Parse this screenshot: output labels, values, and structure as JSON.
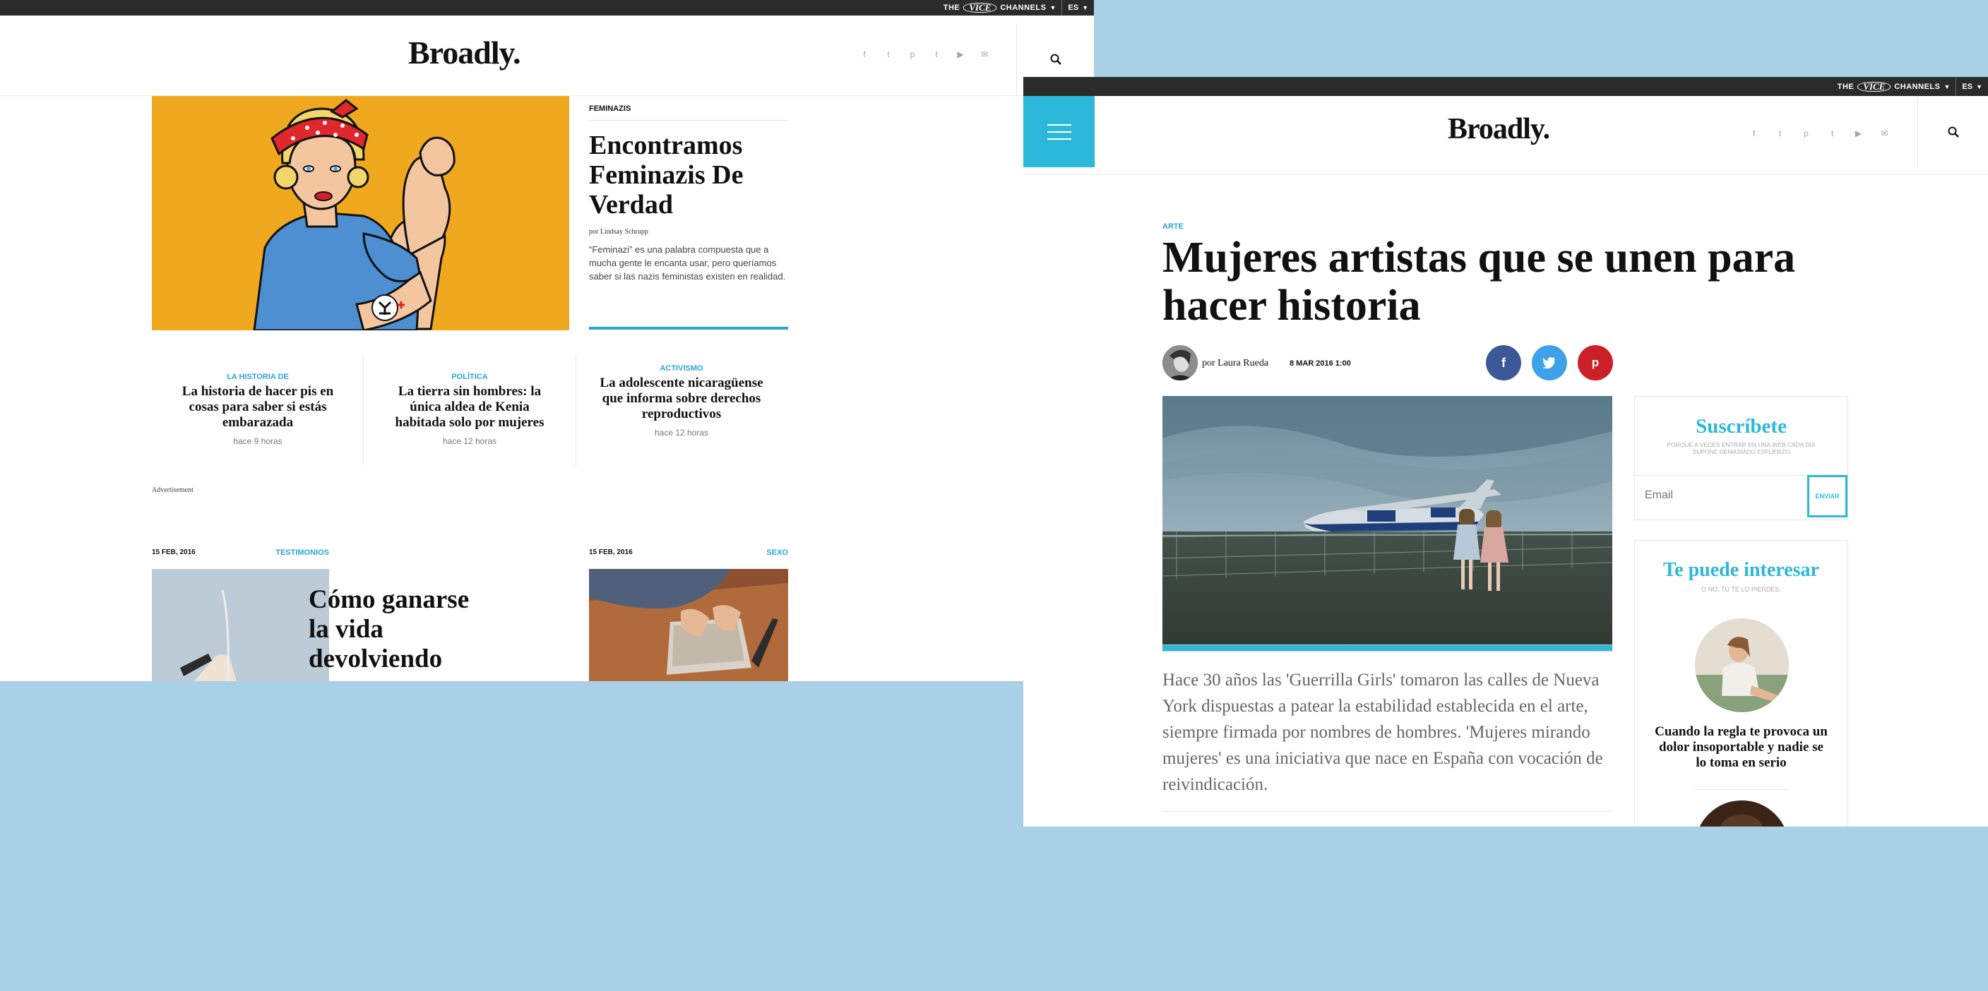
{
  "vice_bar": {
    "the": "THE",
    "vice": "VICE",
    "channels": "CHANNELS",
    "lang": "ES"
  },
  "site": {
    "logo": "Broadly."
  },
  "social_icons": [
    "facebook-icon",
    "twitter-icon",
    "pinterest-icon",
    "tumblr-icon",
    "youtube-icon",
    "email-icon"
  ],
  "home": {
    "featured": {
      "category": "FEMINAZIS",
      "title": "Encontramos Feminazis De Verdad",
      "byline": "por Lindsay Schrupp",
      "excerpt": "“Feminazi” es una palabra compuesta que a mucha gente le encanta usar, pero queríamos saber si las nazis feministas existen en realidad."
    },
    "cards": [
      {
        "category": "LA HISTORIA DE",
        "title": "La historia de hacer pis en cosas para saber si estás embarazada",
        "time": "hace 9 horas"
      },
      {
        "category": "POLÍTICA",
        "title": "La tierra sin hombres: la única aldea de Kenia habitada solo por mujeres",
        "time": "hace 12 horas"
      },
      {
        "category": "ACTIVISMO",
        "title": "La adolescente nicaragüense que informa sobre derechos reproductivos",
        "time": "hace 12 horas"
      }
    ],
    "ad_label": "Advertisement",
    "bottom": [
      {
        "date": "15 FEB, 2016",
        "category": "TESTIMONIOS",
        "title": "Cómo ganarse la vida devolviendo"
      },
      {
        "date": "15 FEB, 2016",
        "category": "SEXO"
      }
    ]
  },
  "article": {
    "category": "ARTE",
    "title": "Mujeres artistas que se unen para hacer historia",
    "author": "por Laura Rueda",
    "date": "8 MAR 2016 1:00",
    "share": [
      "f",
      "t",
      "p"
    ],
    "lead": "Hace 30 años las 'Guerrilla Girls' tomaron las calles de Nueva York dispuestas a patear la estabilidad establecida en el arte, siempre firmada por nombres de hombres. 'Mujeres mirando mujeres' es una iniciativa que nace en España con vocación de reivindicación."
  },
  "subscribe": {
    "title": "Suscríbete",
    "tagline": "PORQUE A VECES ENTRAR EN UNA WEB CADA DÍA SUPONE DEMASIADO ESFUERZO",
    "placeholder": "Email",
    "button": "ENVIAR"
  },
  "related": {
    "title": "Te puede interesar",
    "subtitle": "O NO, TÚ TE LO PIERDES.",
    "items": [
      {
        "title": "Cuando la regla te provoca un dolor insoportable y nadie se lo toma en serio"
      }
    ]
  },
  "colors": {
    "accent": "#2aa6d6",
    "facebook": "#3b5998",
    "twitter": "#3fa1e8",
    "pinterest": "#cb2027",
    "desktop": "#a9d0e6",
    "hero_yellow": "#f0a91f"
  }
}
